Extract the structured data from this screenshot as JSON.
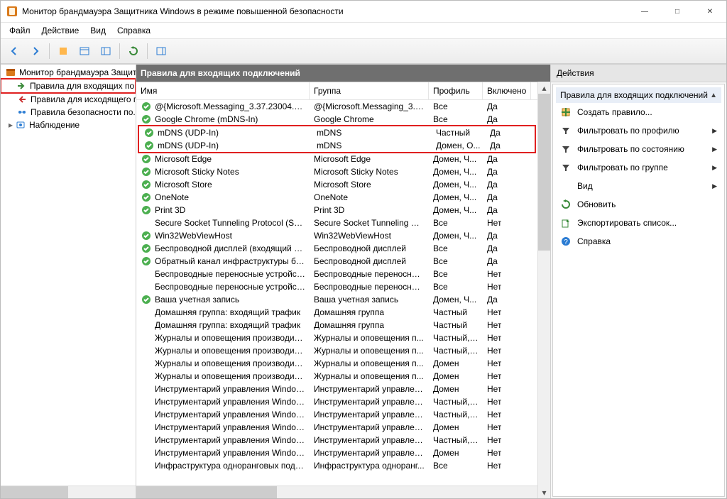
{
  "window": {
    "title": "Монитор брандмауэра Защитника Windows в режиме повышенной безопасности"
  },
  "menu": {
    "file": "Файл",
    "action": "Действие",
    "view": "Вид",
    "help": "Справка"
  },
  "tree": {
    "root": "Монитор брандмауэра Защит",
    "inbound": "Правила для входящих по...",
    "outbound": "Правила для исходящего п...",
    "connsec": "Правила безопасности по...",
    "monitoring": "Наблюдение"
  },
  "content_header": "Правила для входящих подключений",
  "columns": {
    "name": "Имя",
    "group": "Группа",
    "profile": "Профиль",
    "enabled": "Включено"
  },
  "rules": [
    {
      "enabled": true,
      "name": "@{Microsoft.Messaging_3.37.23004.0_x64...",
      "group": "@{Microsoft.Messaging_3.3...",
      "profile": "Все",
      "enabled_text": "Да",
      "hl": false
    },
    {
      "enabled": true,
      "name": "Google Chrome (mDNS-In)",
      "group": "Google Chrome",
      "profile": "Все",
      "enabled_text": "Да",
      "hl": false
    },
    {
      "enabled": true,
      "name": "mDNS (UDP-In)",
      "group": "mDNS",
      "profile": "Частный",
      "enabled_text": "Да",
      "hl": true
    },
    {
      "enabled": true,
      "name": "mDNS (UDP-In)",
      "group": "mDNS",
      "profile": "Домен, О...",
      "enabled_text": "Да",
      "hl": true
    },
    {
      "enabled": true,
      "name": "Microsoft Edge",
      "group": "Microsoft Edge",
      "profile": "Домен, Ч...",
      "enabled_text": "Да",
      "hl": false
    },
    {
      "enabled": true,
      "name": "Microsoft Sticky Notes",
      "group": "Microsoft Sticky Notes",
      "profile": "Домен, Ч...",
      "enabled_text": "Да",
      "hl": false
    },
    {
      "enabled": true,
      "name": "Microsoft Store",
      "group": "Microsoft Store",
      "profile": "Домен, Ч...",
      "enabled_text": "Да",
      "hl": false
    },
    {
      "enabled": true,
      "name": "OneNote",
      "group": "OneNote",
      "profile": "Домен, Ч...",
      "enabled_text": "Да",
      "hl": false
    },
    {
      "enabled": true,
      "name": "Print 3D",
      "group": "Print 3D",
      "profile": "Домен, Ч...",
      "enabled_text": "Да",
      "hl": false
    },
    {
      "enabled": false,
      "name": "Secure Socket Tunneling Protocol (SSTP-...",
      "group": "Secure Socket Tunneling Pr...",
      "profile": "Все",
      "enabled_text": "Нет",
      "hl": false
    },
    {
      "enabled": true,
      "name": "Win32WebViewHost",
      "group": "Win32WebViewHost",
      "profile": "Домен, Ч...",
      "enabled_text": "Да",
      "hl": false
    },
    {
      "enabled": true,
      "name": "Беспроводной дисплей (входящий тра...",
      "group": "Беспроводной дисплей",
      "profile": "Все",
      "enabled_text": "Да",
      "hl": false
    },
    {
      "enabled": true,
      "name": "Обратный канал инфраструктуры бесп...",
      "group": "Беспроводной дисплей",
      "profile": "Все",
      "enabled_text": "Да",
      "hl": false
    },
    {
      "enabled": false,
      "name": "Беспроводные переносные устройства...",
      "group": "Беспроводные переносны...",
      "profile": "Все",
      "enabled_text": "Нет",
      "hl": false
    },
    {
      "enabled": false,
      "name": "Беспроводные переносные устройства...",
      "group": "Беспроводные переносны...",
      "profile": "Все",
      "enabled_text": "Нет",
      "hl": false
    },
    {
      "enabled": true,
      "name": "Ваша учетная запись",
      "group": "Ваша учетная запись",
      "profile": "Домен, Ч...",
      "enabled_text": "Да",
      "hl": false
    },
    {
      "enabled": false,
      "name": "Домашняя группа: входящий трафик",
      "group": "Домашняя группа",
      "profile": "Частный",
      "enabled_text": "Нет",
      "hl": false
    },
    {
      "enabled": false,
      "name": "Домашняя группа: входящий трафик",
      "group": "Домашняя группа",
      "profile": "Частный",
      "enabled_text": "Нет",
      "hl": false
    },
    {
      "enabled": false,
      "name": "Журналы и оповещения производител...",
      "group": "Журналы и оповещения п...",
      "profile": "Частный, ...",
      "enabled_text": "Нет",
      "hl": false
    },
    {
      "enabled": false,
      "name": "Журналы и оповещения производител...",
      "group": "Журналы и оповещения п...",
      "profile": "Частный, ...",
      "enabled_text": "Нет",
      "hl": false
    },
    {
      "enabled": false,
      "name": "Журналы и оповещения производител...",
      "group": "Журналы и оповещения п...",
      "profile": "Домен",
      "enabled_text": "Нет",
      "hl": false
    },
    {
      "enabled": false,
      "name": "Журналы и оповещения производител...",
      "group": "Журналы и оповещения п...",
      "profile": "Домен",
      "enabled_text": "Нет",
      "hl": false
    },
    {
      "enabled": false,
      "name": "Инструментарий управления Windows ...",
      "group": "Инструментарий управлен...",
      "profile": "Домен",
      "enabled_text": "Нет",
      "hl": false
    },
    {
      "enabled": false,
      "name": "Инструментарий управления Windows ...",
      "group": "Инструментарий управлен...",
      "profile": "Частный, ...",
      "enabled_text": "Нет",
      "hl": false
    },
    {
      "enabled": false,
      "name": "Инструментарий управления Windows ...",
      "group": "Инструментарий управлен...",
      "profile": "Частный, ...",
      "enabled_text": "Нет",
      "hl": false
    },
    {
      "enabled": false,
      "name": "Инструментарий управления Windows ...",
      "group": "Инструментарий управлен...",
      "profile": "Домен",
      "enabled_text": "Нет",
      "hl": false
    },
    {
      "enabled": false,
      "name": "Инструментарий управления Windows ...",
      "group": "Инструментарий управлен...",
      "profile": "Частный, ...",
      "enabled_text": "Нет",
      "hl": false
    },
    {
      "enabled": false,
      "name": "Инструментарий управления Windows ...",
      "group": "Инструментарий управлен...",
      "profile": "Домен",
      "enabled_text": "Нет",
      "hl": false
    },
    {
      "enabled": false,
      "name": "Инфраструктура одноранговых подкл...",
      "group": "Инфраструктура одноранг...",
      "profile": "Все",
      "enabled_text": "Нет",
      "hl": false
    }
  ],
  "actions": {
    "panel_title": "Действия",
    "group_title": "Правила для входящих подключений",
    "items": [
      {
        "icon": "new-rule-icon",
        "label": "Создать правило...",
        "submenu": false
      },
      {
        "icon": "filter-icon",
        "label": "Фильтровать по профилю",
        "submenu": true
      },
      {
        "icon": "filter-icon",
        "label": "Фильтровать по состоянию",
        "submenu": true
      },
      {
        "icon": "filter-icon",
        "label": "Фильтровать по группе",
        "submenu": true
      },
      {
        "icon": "blank-icon",
        "label": "Вид",
        "submenu": true
      },
      {
        "icon": "refresh-icon",
        "label": "Обновить",
        "submenu": false
      },
      {
        "icon": "export-icon",
        "label": "Экспортировать список...",
        "submenu": false
      },
      {
        "icon": "help-icon",
        "label": "Справка",
        "submenu": false
      }
    ]
  }
}
